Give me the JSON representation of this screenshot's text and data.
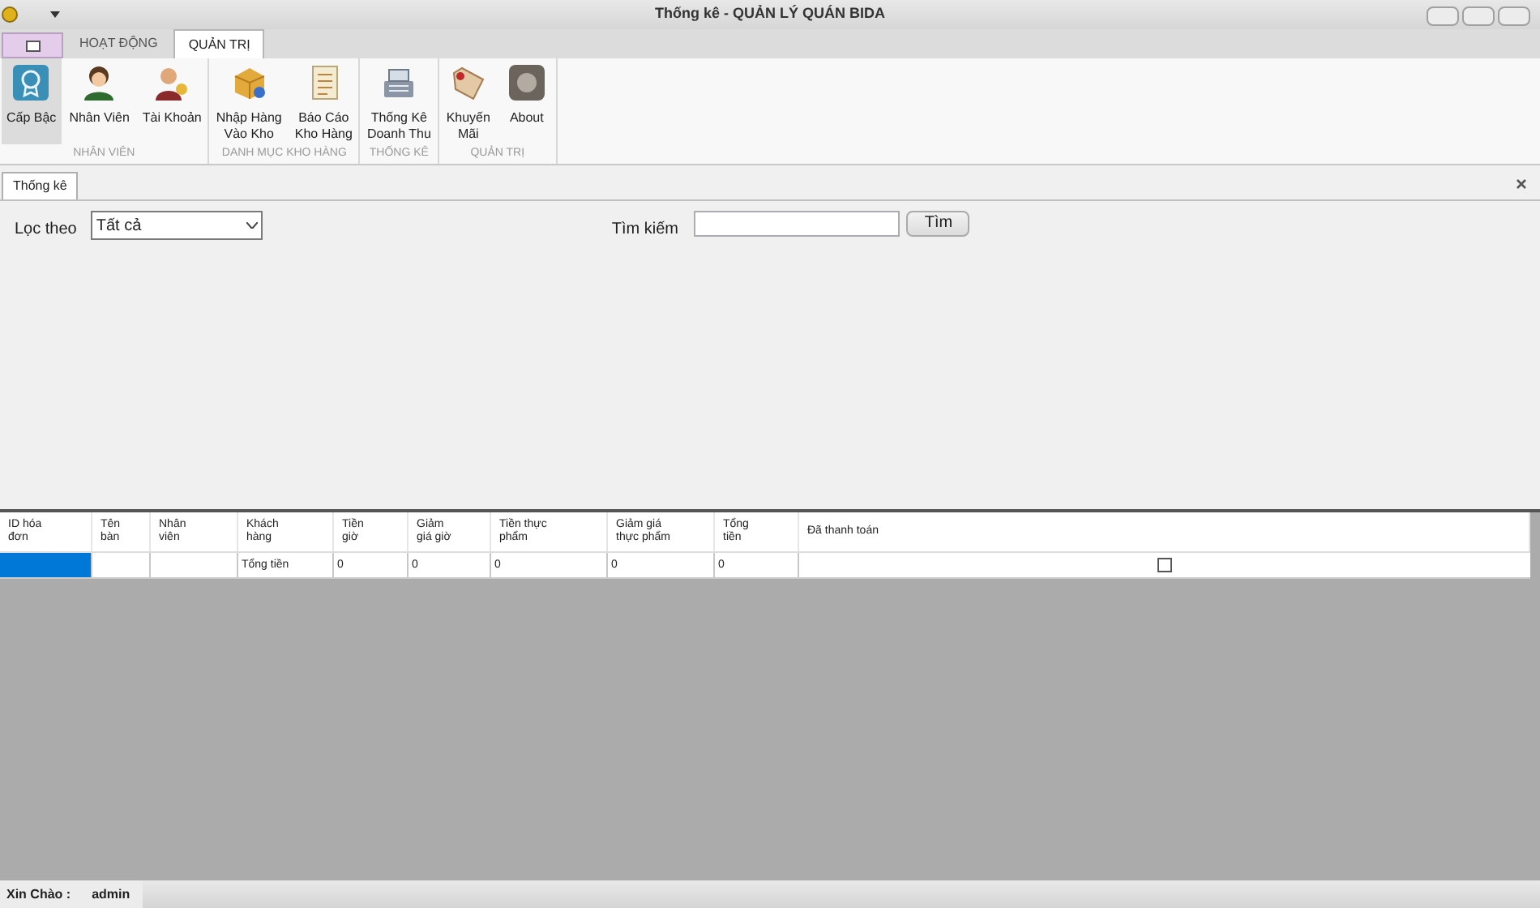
{
  "window": {
    "title": "Thống kê - QUẢN LÝ QUÁN BIDA"
  },
  "ribbon_tabs": [
    {
      "label": "HOẠT ĐỘNG",
      "selected": false
    },
    {
      "label": "QUẢN TRỊ",
      "selected": true
    }
  ],
  "ribbon_groups": [
    {
      "label": "NHÂN VIÊN",
      "buttons": [
        {
          "label": "Cấp Bậc",
          "kind": "badge",
          "selected": true
        },
        {
          "label": "Nhân Viên",
          "kind": "person",
          "selected": false
        },
        {
          "label": "Tài Khoản",
          "kind": "key",
          "selected": false
        }
      ]
    },
    {
      "label": "DANH MỤC KHO HÀNG",
      "buttons": [
        {
          "label": "Nhập Hàng\nVào Kho",
          "kind": "box",
          "selected": false
        },
        {
          "label": "Báo Cáo\nKho Hàng",
          "kind": "report",
          "selected": false
        }
      ]
    },
    {
      "label": "THỐNG KÊ",
      "buttons": [
        {
          "label": "Thống Kê\nDoanh Thu",
          "kind": "register",
          "selected": false
        }
      ]
    },
    {
      "label": "QUẢN TRỊ",
      "buttons": [
        {
          "label": "Khuyến\nMãi",
          "kind": "tag",
          "selected": false
        },
        {
          "label": "About",
          "kind": "about",
          "selected": false
        }
      ]
    }
  ],
  "document_tab": {
    "label": "Thống kê"
  },
  "filter": {
    "label": "Lọc theo",
    "value": "Tất cả"
  },
  "search": {
    "label": "Tìm kiếm",
    "button": "Tìm"
  },
  "table": {
    "columns": [
      "ID hóa\nđơn",
      "Tên\nbàn",
      "Nhân\nviên",
      "Khách\nhàng",
      "Tiền\ngiờ",
      "Giảm\ngiá giờ",
      "Tiền thực\nphẩm",
      "Giảm giá\nthực phẩm",
      "Tổng\ntiền",
      "Đã thanh toán"
    ],
    "rows": [
      {
        "selected": true,
        "cells": [
          "",
          "",
          "",
          "Tổng tiền",
          "0",
          "0",
          "0",
          "0",
          "0"
        ],
        "paid": false
      }
    ]
  },
  "status_bar": {
    "label": "Xin Chào :",
    "user": "admin"
  }
}
